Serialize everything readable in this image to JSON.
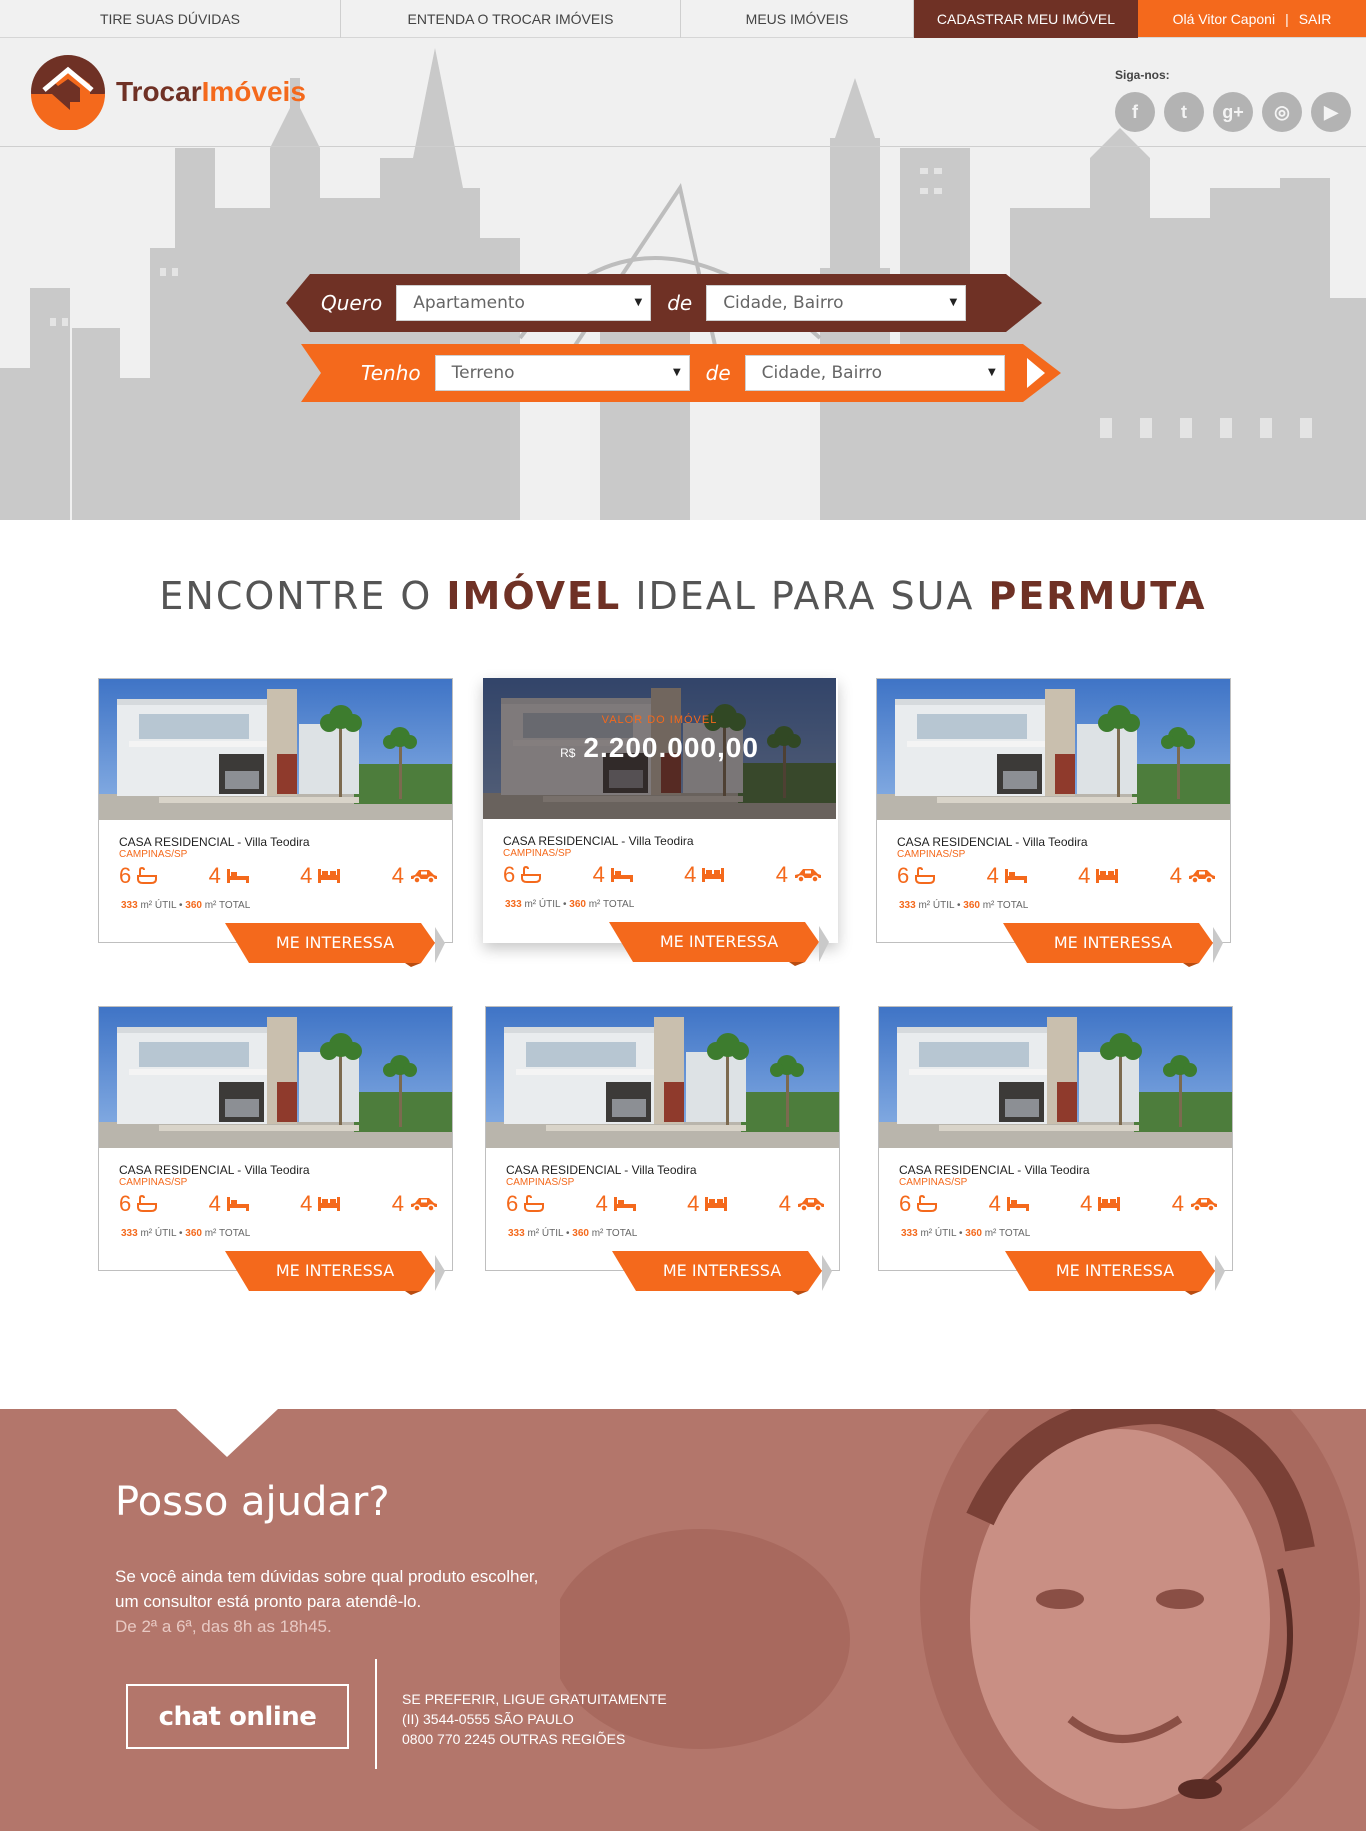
{
  "topnav": {
    "faq": "TIRE SUAS DÚVIDAS",
    "about": "ENTENDA O TROCAR IMÓVEIS",
    "my_properties": "MEUS IMÓVEIS",
    "register": "CADASTRAR MEU IMÓVEL",
    "greeting": "Olá Vitor Caponi",
    "separator": "|",
    "logout": "SAIR"
  },
  "brand": {
    "part1": "Trocar",
    "part2": "Imóveis"
  },
  "social": {
    "label": "Siga-nos:",
    "icons": [
      "facebook-icon",
      "twitter-icon",
      "google-plus-icon",
      "instagram-icon",
      "youtube-icon"
    ],
    "glyphs": [
      "f",
      "t",
      "g+",
      "◎",
      "▶"
    ]
  },
  "search": {
    "want_label": "Quero",
    "want_type": "Apartamento",
    "want_of": "de",
    "want_location": "Cidade, Bairro",
    "have_label": "Tenho",
    "have_type": "Terreno",
    "have_of": "de",
    "have_location": "Cidade, Bairro"
  },
  "headline": {
    "part1": "ENCONTRE O ",
    "strong1": "IMÓVEL",
    "part2": " IDEAL PARA SUA ",
    "strong2": "PERMUTA"
  },
  "listings": [
    {
      "type": "CASA RESIDENCIAL",
      "name": " - Villa Teodira",
      "city": "CAMPINAS/SP",
      "baths": "6",
      "rooms": "4",
      "beds": "4",
      "garage": "4",
      "util": "333",
      "util_unit": " m² ÚTIL • ",
      "total": "360",
      "total_unit": " m² TOTAL",
      "cta": "ME INTERESSA"
    },
    {
      "type": "CASA RESIDENCIAL",
      "name": " - Villa Teodira",
      "city": "CAMPINAS/SP",
      "baths": "6",
      "rooms": "4",
      "beds": "4",
      "garage": "4",
      "util": "333",
      "util_unit": " m² ÚTIL • ",
      "total": "360",
      "total_unit": " m² TOTAL",
      "cta": "ME INTERESSA",
      "price_label": "VALOR DO IMÓVEL",
      "price_currency": "R$",
      "price_value": "2.200.000,00"
    },
    {
      "type": "CASA RESIDENCIAL",
      "name": " - Villa Teodira",
      "city": "CAMPINAS/SP",
      "baths": "6",
      "rooms": "4",
      "beds": "4",
      "garage": "4",
      "util": "333",
      "util_unit": " m² ÚTIL • ",
      "total": "360",
      "total_unit": " m² TOTAL",
      "cta": "ME INTERESSA"
    },
    {
      "type": "CASA RESIDENCIAL",
      "name": " - Villa Teodira",
      "city": "CAMPINAS/SP",
      "baths": "6",
      "rooms": "4",
      "beds": "4",
      "garage": "4",
      "util": "333",
      "util_unit": " m² ÚTIL • ",
      "total": "360",
      "total_unit": " m² TOTAL",
      "cta": "ME INTERESSA"
    },
    {
      "type": "CASA RESIDENCIAL",
      "name": " - Villa Teodira",
      "city": "CAMPINAS/SP",
      "baths": "6",
      "rooms": "4",
      "beds": "4",
      "garage": "4",
      "util": "333",
      "util_unit": " m² ÚTIL • ",
      "total": "360",
      "total_unit": " m² TOTAL",
      "cta": "ME INTERESSA"
    },
    {
      "type": "CASA RESIDENCIAL",
      "name": " - Villa Teodira",
      "city": "CAMPINAS/SP",
      "baths": "6",
      "rooms": "4",
      "beds": "4",
      "garage": "4",
      "util": "333",
      "util_unit": " m² ÚTIL • ",
      "total": "360",
      "total_unit": " m² TOTAL",
      "cta": "ME INTERESSA"
    }
  ],
  "help": {
    "title": "Posso ajudar?",
    "desc_line1": "Se você ainda tem dúvidas sobre qual produto escolher,",
    "desc_line2": "um consultor está pronto para atendê-lo.",
    "hours": "De 2ª a 6ª, das 8h as 18h45.",
    "chat_button": "chat online",
    "phone_intro": "SE PREFERIR, LIGUE GRATUITAMENTE",
    "phone_sp": "(II) 3544-0555 SÃO PAULO",
    "phone_other": "0800 770 2245 OUTRAS REGIÕES"
  },
  "colors": {
    "brand_brown": "#6f3125",
    "brand_orange": "#f4691c",
    "help_bg": "#b3766b"
  }
}
